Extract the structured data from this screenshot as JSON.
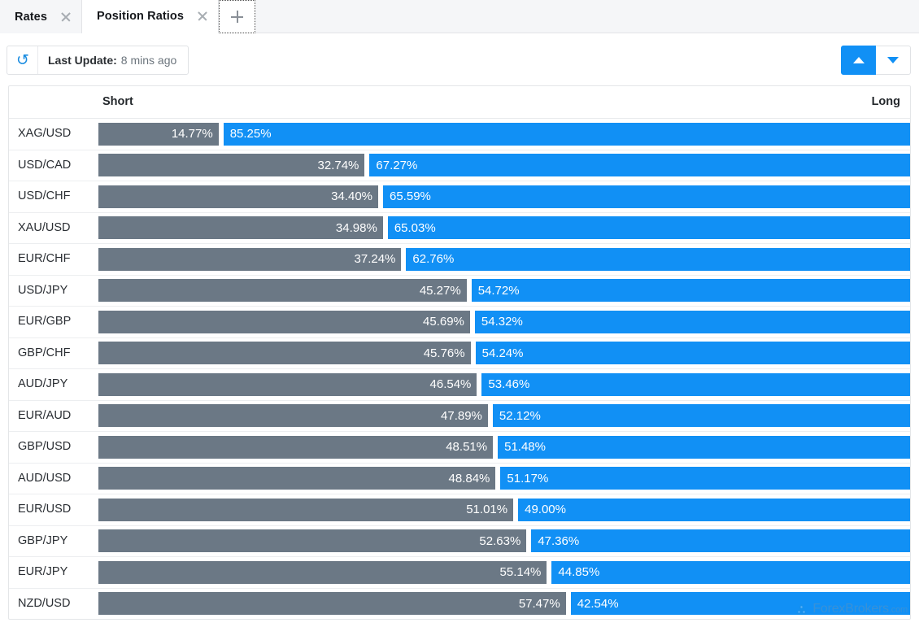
{
  "tabs": [
    {
      "label": "Rates",
      "active": false,
      "close_icon": "close-icon"
    },
    {
      "label": "Position Ratios",
      "active": true,
      "close_icon": "close-icon"
    }
  ],
  "add_tab": {
    "icon": "plus-icon",
    "label": "+"
  },
  "toolbar": {
    "refresh_icon": "refresh-icon",
    "refresh_glyph": "↻",
    "last_update_label": "Last Update:",
    "last_update_value": "8 mins ago",
    "sort_asc": {
      "icon": "triangle-up-icon",
      "active": true
    },
    "sort_desc": {
      "icon": "triangle-down-icon",
      "active": false
    }
  },
  "table": {
    "header": {
      "short": "Short",
      "long": "Long"
    },
    "colors": {
      "short_bar": "#6b7885",
      "long_bar": "#1190f5",
      "accent": "#1190f5"
    },
    "rows": [
      {
        "pair": "XAG/USD",
        "short": "14.77%",
        "long": "85.25%",
        "short_pct": 14.77,
        "long_pct": 85.25
      },
      {
        "pair": "USD/CAD",
        "short": "32.74%",
        "long": "67.27%",
        "short_pct": 32.74,
        "long_pct": 67.27
      },
      {
        "pair": "USD/CHF",
        "short": "34.40%",
        "long": "65.59%",
        "short_pct": 34.4,
        "long_pct": 65.59
      },
      {
        "pair": "XAU/USD",
        "short": "34.98%",
        "long": "65.03%",
        "short_pct": 34.98,
        "long_pct": 65.03
      },
      {
        "pair": "EUR/CHF",
        "short": "37.24%",
        "long": "62.76%",
        "short_pct": 37.24,
        "long_pct": 62.76
      },
      {
        "pair": "USD/JPY",
        "short": "45.27%",
        "long": "54.72%",
        "short_pct": 45.27,
        "long_pct": 54.72
      },
      {
        "pair": "EUR/GBP",
        "short": "45.69%",
        "long": "54.32%",
        "short_pct": 45.69,
        "long_pct": 54.32
      },
      {
        "pair": "GBP/CHF",
        "short": "45.76%",
        "long": "54.24%",
        "short_pct": 45.76,
        "long_pct": 54.24
      },
      {
        "pair": "AUD/JPY",
        "short": "46.54%",
        "long": "53.46%",
        "short_pct": 46.54,
        "long_pct": 53.46
      },
      {
        "pair": "EUR/AUD",
        "short": "47.89%",
        "long": "52.12%",
        "short_pct": 47.89,
        "long_pct": 52.12
      },
      {
        "pair": "GBP/USD",
        "short": "48.51%",
        "long": "51.48%",
        "short_pct": 48.51,
        "long_pct": 51.48
      },
      {
        "pair": "AUD/USD",
        "short": "48.84%",
        "long": "51.17%",
        "short_pct": 48.84,
        "long_pct": 51.17
      },
      {
        "pair": "EUR/USD",
        "short": "51.01%",
        "long": "49.00%",
        "short_pct": 51.01,
        "long_pct": 49.0
      },
      {
        "pair": "GBP/JPY",
        "short": "52.63%",
        "long": "47.36%",
        "short_pct": 52.63,
        "long_pct": 47.36
      },
      {
        "pair": "EUR/JPY",
        "short": "55.14%",
        "long": "44.85%",
        "short_pct": 55.14,
        "long_pct": 44.85
      },
      {
        "pair": "NZD/USD",
        "short": "57.47%",
        "long": "42.54%",
        "short_pct": 57.47,
        "long_pct": 42.54
      }
    ]
  },
  "watermark": {
    "name": "ForexBrokers",
    "domain": ".com",
    "logo_icon": "forexbrokers-logo-icon"
  },
  "chart_data": {
    "type": "bar",
    "title": "Position Ratios",
    "orientation": "horizontal-stacked",
    "categories": [
      "XAG/USD",
      "USD/CAD",
      "USD/CHF",
      "XAU/USD",
      "EUR/CHF",
      "USD/JPY",
      "EUR/GBP",
      "GBP/CHF",
      "AUD/JPY",
      "EUR/AUD",
      "GBP/USD",
      "AUD/USD",
      "EUR/USD",
      "GBP/JPY",
      "EUR/JPY",
      "NZD/USD"
    ],
    "series": [
      {
        "name": "Short",
        "color": "#6b7885",
        "values": [
          14.77,
          32.74,
          34.4,
          34.98,
          37.24,
          45.27,
          45.69,
          45.76,
          46.54,
          47.89,
          48.51,
          48.84,
          51.01,
          52.63,
          55.14,
          57.47
        ]
      },
      {
        "name": "Long",
        "color": "#1190f5",
        "values": [
          85.25,
          67.27,
          65.59,
          65.03,
          62.76,
          54.72,
          54.32,
          54.24,
          53.46,
          52.12,
          51.48,
          51.17,
          49.0,
          47.36,
          44.85,
          42.54
        ]
      }
    ],
    "xlabel": "",
    "ylabel": "",
    "xlim": [
      0,
      100
    ],
    "grid": false,
    "legend": "top"
  }
}
